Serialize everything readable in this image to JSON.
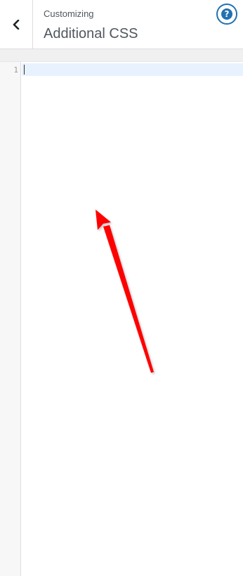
{
  "header": {
    "back_icon": "chevron-left-icon",
    "subtitle": "Customizing",
    "title": "Additional CSS",
    "help_icon": "question-mark-icon",
    "help_glyph": "?"
  },
  "editor": {
    "line_numbers": [
      "1"
    ],
    "active_line_color": "#e8f2ff"
  },
  "annotation": {
    "arrow_color": "#ff0000"
  },
  "colors": {
    "accent": "#2271b1",
    "text": "#50575e",
    "gutter": "#f7f7f7"
  }
}
